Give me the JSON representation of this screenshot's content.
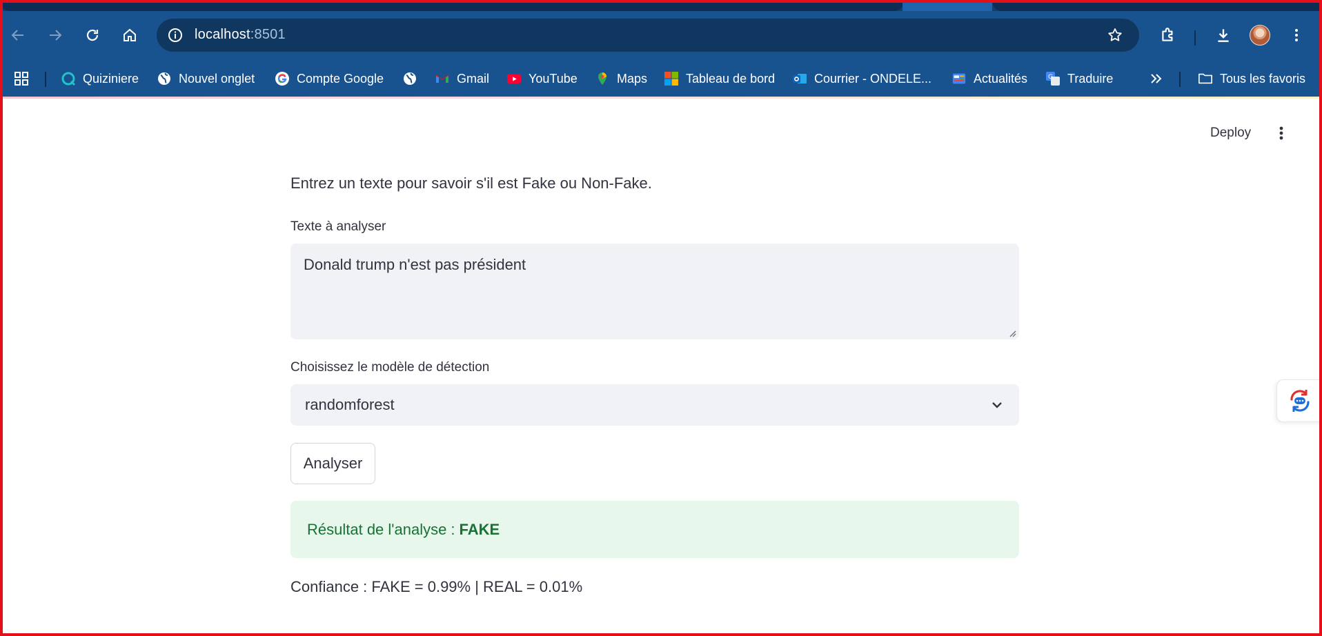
{
  "browser": {
    "url_host": "localhost",
    "url_port": ":8501",
    "bookmarks": [
      {
        "label": "Quiziniere",
        "icon": "quiziniere-icon"
      },
      {
        "label": "Nouvel onglet",
        "icon": "globe-icon"
      },
      {
        "label": "Compte Google",
        "icon": "google-icon"
      },
      {
        "label": "",
        "icon": "globe-icon"
      },
      {
        "label": "Gmail",
        "icon": "gmail-icon"
      },
      {
        "label": "YouTube",
        "icon": "youtube-icon"
      },
      {
        "label": "Maps",
        "icon": "maps-icon"
      },
      {
        "label": "Tableau de bord",
        "icon": "microsoft-icon"
      },
      {
        "label": "Courrier - ONDELE...",
        "icon": "outlook-icon"
      },
      {
        "label": "Actualités",
        "icon": "news-icon"
      },
      {
        "label": "Traduire",
        "icon": "translate-icon"
      }
    ],
    "all_bookmarks_label": "Tous les favoris"
  },
  "app": {
    "deploy_label": "Deploy",
    "intro_text": "Entrez un texte pour savoir s'il est Fake ou Non-Fake.",
    "text_label": "Texte à analyser",
    "text_value": "Donald trump n'est pas président",
    "model_label": "Choisissez le modèle de détection",
    "model_value": "randomforest",
    "analyze_button": "Analyser",
    "result_prefix": "Résultat de l'analyse :",
    "result_value": "FAKE",
    "confidence_text": "Confiance : FAKE = 0.99% | REAL = 0.01%"
  },
  "colors": {
    "chrome": "#18528f",
    "success_bg": "#e7f7ec",
    "success_text": "#177233",
    "input_bg": "#f0f2f6"
  }
}
